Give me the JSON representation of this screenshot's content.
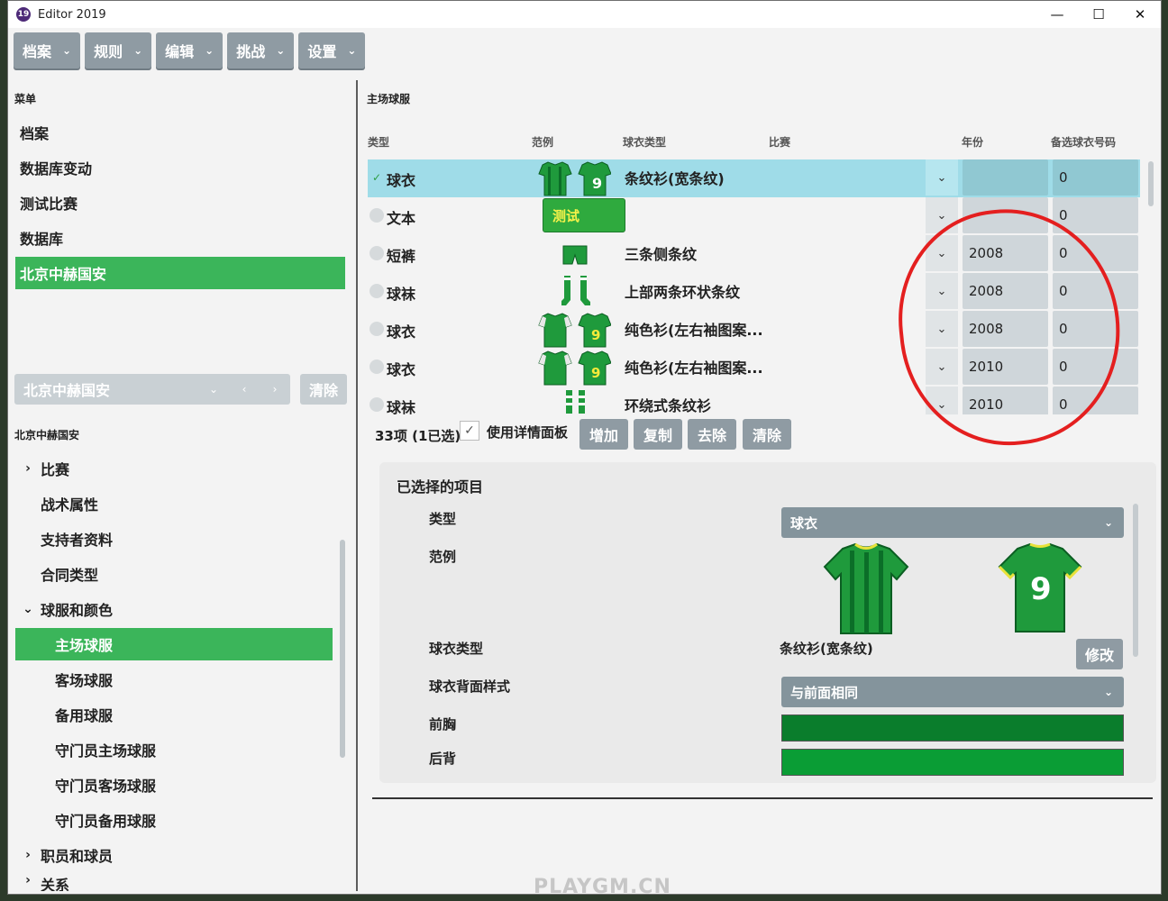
{
  "window": {
    "title": "Editor 2019",
    "icon_letter": "19",
    "minimize": "—",
    "maximize": "☐",
    "close": "✕"
  },
  "menu": [
    {
      "label": "档案"
    },
    {
      "label": "规则"
    },
    {
      "label": "编辑"
    },
    {
      "label": "挑战"
    },
    {
      "label": "设置"
    }
  ],
  "left": {
    "menu_title": "菜单",
    "nav": [
      "档案",
      "数据库变动",
      "测试比赛",
      "数据库",
      "北京中赫国安"
    ],
    "club_select": "北京中赫国安",
    "clear": "清除",
    "club_title": "北京中赫国安",
    "tree": [
      {
        "label": "比赛",
        "arrow": "›"
      },
      {
        "label": "战术属性",
        "arrow": ""
      },
      {
        "label": "支持者资料",
        "arrow": ""
      },
      {
        "label": "合同类型",
        "arrow": ""
      },
      {
        "label": "球服和颜色",
        "arrow": "⌄"
      },
      {
        "label": "主场球服",
        "arrow": ""
      },
      {
        "label": "客场球服",
        "arrow": ""
      },
      {
        "label": "备用球服",
        "arrow": ""
      },
      {
        "label": "守门员主场球服",
        "arrow": ""
      },
      {
        "label": "守门员客场球服",
        "arrow": ""
      },
      {
        "label": "守门员备用球服",
        "arrow": ""
      },
      {
        "label": "职员和球员",
        "arrow": "›"
      },
      {
        "label": "关系",
        "arrow": "›"
      }
    ]
  },
  "right": {
    "section_title": "主场球服",
    "columns": {
      "type": "类型",
      "sample": "范例",
      "kit_type": "球衣类型",
      "match": "比赛",
      "year": "年份",
      "alt_no": "备选球衣号码"
    },
    "rows": [
      {
        "type": "球衣",
        "design": "条纹衫(宽条纹)",
        "year": "",
        "alt": "0",
        "selected": true
      },
      {
        "type": "文本",
        "design": "",
        "year": "",
        "alt": "0"
      },
      {
        "type": "短裤",
        "design": "三条侧条纹",
        "year": "2008",
        "alt": "0"
      },
      {
        "type": "球袜",
        "design": "上部两条环状条纹",
        "year": "2008",
        "alt": "0"
      },
      {
        "type": "球衣",
        "design": "纯色衫(左右袖图案...",
        "year": "2008",
        "alt": "0"
      },
      {
        "type": "球衣",
        "design": "纯色衫(左右袖图案...",
        "year": "2010",
        "alt": "0"
      },
      {
        "type": "球袜",
        "design": "环绕式条纹衫",
        "year": "2010",
        "alt": "0"
      }
    ],
    "tooltip": "测试",
    "count": "33项 (1已选)",
    "use_detail": "使用详情面板",
    "actions": [
      "增加",
      "复制",
      "去除",
      "清除"
    ],
    "detail": {
      "title": "已选择的项目",
      "type_label": "类型",
      "type_value": "球衣",
      "sample_label": "范例",
      "kit_type_label": "球衣类型",
      "kit_type_value": "条纹衫(宽条纹)",
      "edit": "修改",
      "back_label": "球衣背面样式",
      "back_value": "与前面相同",
      "chest_label": "前胸",
      "back_color_label": "后背",
      "chest_color": "#0a7d2c",
      "back_color": "#0a9d35",
      "shirt_number": "9"
    }
  },
  "watermark": "PLAYGM.CN"
}
